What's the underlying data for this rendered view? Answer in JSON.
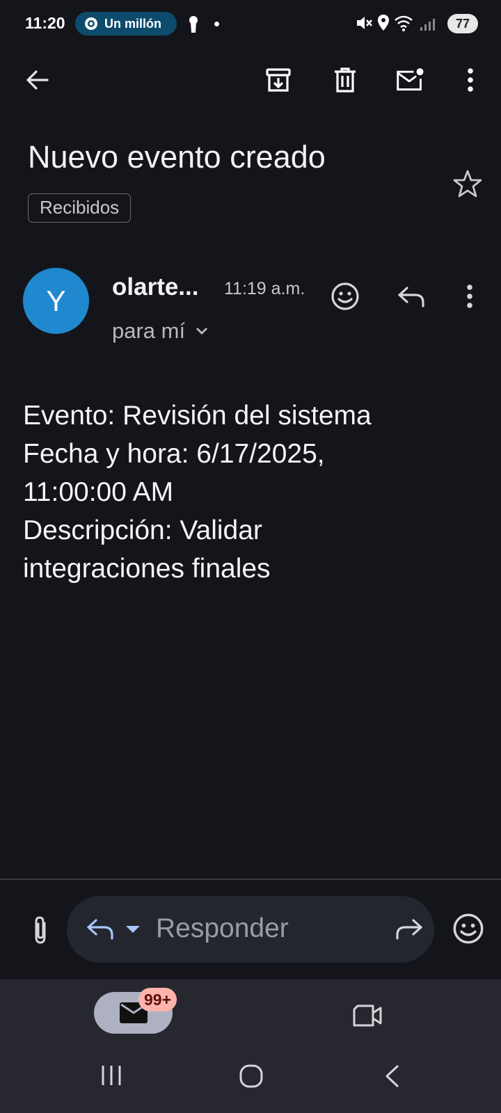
{
  "status_bar": {
    "time": "11:20",
    "media_pill": "Un millón",
    "battery": "77"
  },
  "email": {
    "subject": "Nuevo evento creado",
    "label": "Recibidos",
    "sender_initial": "Y",
    "sender": "olarte...",
    "time": "11:19 a.m.",
    "recipient": "para mí",
    "body_lines": [
      "Evento: Revisión del sistema",
      "Fecha y hora: 6/17/2025,",
      "11:00:00 AM",
      "Descripción: Validar",
      "integraciones finales"
    ]
  },
  "reply_bar": {
    "placeholder": "Responder"
  },
  "bottom_nav": {
    "mail_badge": "99+"
  },
  "colors": {
    "background": "#14151b",
    "avatar": "#1f88cf",
    "pill": "#0d4b6c",
    "badge": "#ffb4ab"
  }
}
